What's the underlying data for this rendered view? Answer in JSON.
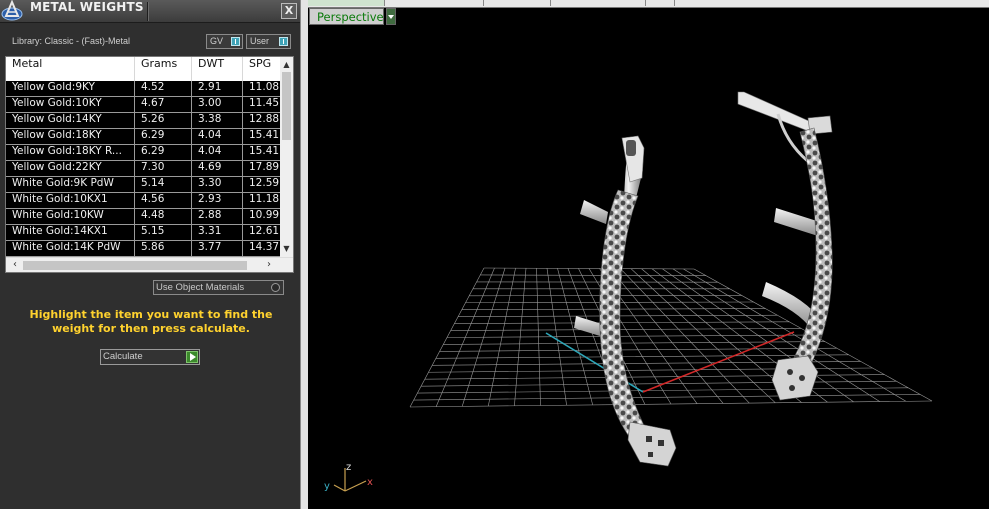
{
  "panel": {
    "title": "METAL WEIGHTS",
    "close_label": "X",
    "library_label": "Library: Classic - (Fast)-Metal",
    "toggles": {
      "gv": "GV",
      "user": "User"
    },
    "columns": [
      "Metal",
      "Grams",
      "DWT",
      "SPG"
    ],
    "rows": [
      [
        "Yellow Gold:9KY",
        "4.52",
        "2.91",
        "11.08"
      ],
      [
        "Yellow Gold:10KY",
        "4.67",
        "3.00",
        "11.45"
      ],
      [
        "Yellow Gold:14KY",
        "5.26",
        "3.38",
        "12.88"
      ],
      [
        "Yellow Gold:18KY",
        "6.29",
        "4.04",
        "15.41"
      ],
      [
        "Yellow Gold:18KY R...",
        "6.29",
        "4.04",
        "15.41"
      ],
      [
        "Yellow Gold:22KY",
        "7.30",
        "4.69",
        "17.89"
      ],
      [
        "White Gold:9K PdW",
        "5.14",
        "3.30",
        "12.59"
      ],
      [
        "White Gold:10KX1",
        "4.56",
        "2.93",
        "11.18"
      ],
      [
        "White Gold:10KW",
        "4.48",
        "2.88",
        "10.99"
      ],
      [
        "White Gold:14KX1",
        "5.15",
        "3.31",
        "12.61"
      ],
      [
        "White Gold:14K PdW",
        "5.86",
        "3.77",
        "14.37"
      ]
    ],
    "use_object_materials": "Use Object Materials",
    "instructions": "Highlight the item you want to find the weight for then press calculate.",
    "calculate_label": "Calculate"
  },
  "viewport": {
    "view_mode": "Perspective",
    "axes": {
      "x": "x",
      "y": "y",
      "z": "z"
    },
    "colors": {
      "x_axis": "#d22828",
      "y_axis": "#2ea6b8",
      "grid": "#9a9a9a",
      "model": "#d8d8d8"
    }
  }
}
